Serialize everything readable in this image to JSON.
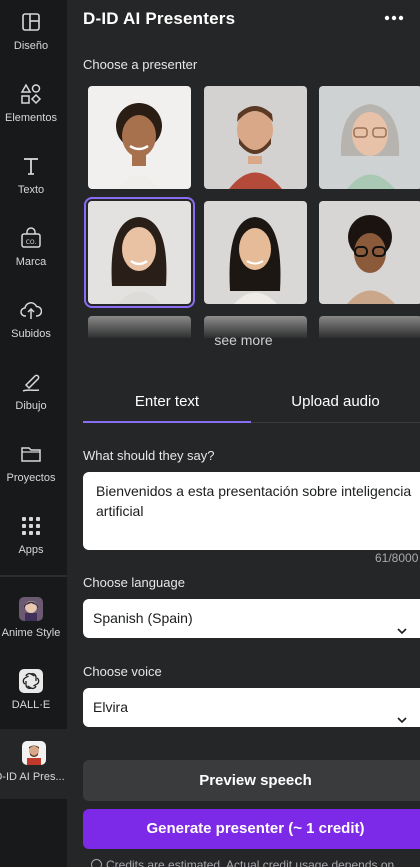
{
  "rail": {
    "items": [
      {
        "label": "Diseño",
        "icon": "layout-icon"
      },
      {
        "label": "Elementos",
        "icon": "shapes-icon"
      },
      {
        "label": "Texto",
        "icon": "text-icon"
      },
      {
        "label": "Marca",
        "icon": "brand-icon"
      },
      {
        "label": "Subidos",
        "icon": "upload-cloud-icon"
      },
      {
        "label": "Dibujo",
        "icon": "draw-icon"
      },
      {
        "label": "Proyectos",
        "icon": "folder-icon"
      },
      {
        "label": "Apps",
        "icon": "apps-grid-icon"
      }
    ],
    "apps": [
      {
        "label": "Anime Style"
      },
      {
        "label": "DALL·E"
      },
      {
        "label": "D-ID AI Pres..."
      }
    ]
  },
  "panel": {
    "title": "D-ID AI Presenters",
    "choose_presenter_label": "Choose a presenter",
    "see_more": "see more",
    "tabs": [
      {
        "label": "Enter text",
        "active": true
      },
      {
        "label": "Upload audio",
        "active": false
      }
    ],
    "prompt_label": "What should they say?",
    "prompt_value": "Bienvenidos a esta presentación sobre inteligencia artificial",
    "char_counter": "61/8000",
    "language_label": "Choose language",
    "language_value": "Spanish (Spain)",
    "voice_label": "Choose voice",
    "voice_value": "Elvira",
    "preview_button": "Preview speech",
    "generate_button": "Generate presenter (~ 1 credit)",
    "note": "Credits are estimated. Actual credit usage depends on"
  },
  "colors": {
    "accent": "#7d2ae8",
    "tab_underline": "#8b6cf5",
    "panel_bg": "#252627",
    "rail_bg": "#18191b"
  }
}
